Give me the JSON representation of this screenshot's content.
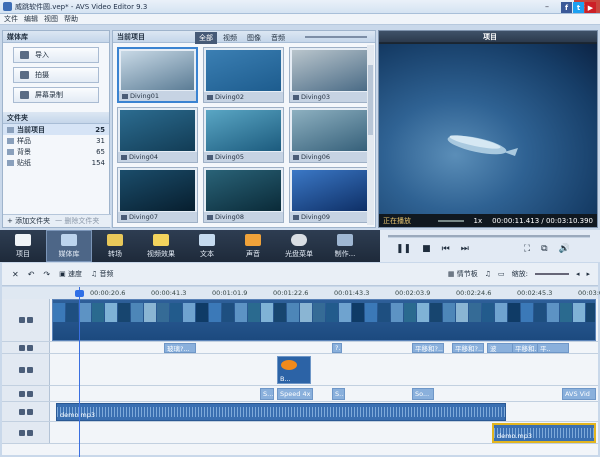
{
  "window": {
    "title": "威跳软件圆.vep* - AVS Video Editor 9.3",
    "minimize": "–",
    "maximize": "□",
    "close": "✕"
  },
  "menu": [
    "文件",
    "编辑",
    "视图",
    "帮助"
  ],
  "social": [
    {
      "name": "facebook",
      "color": "#3b5998",
      "glyph": "f"
    },
    {
      "name": "twitter",
      "color": "#1da1f2",
      "glyph": "t"
    },
    {
      "name": "youtube",
      "color": "#cc2027",
      "glyph": "▶"
    }
  ],
  "library": {
    "header": "媒体库",
    "buttons": [
      "导入",
      "拍摄",
      "屏幕录制"
    ],
    "folders_header": "文件夹",
    "folders": [
      {
        "name": "当前项目",
        "count": "25",
        "selected": true
      },
      {
        "name": "样品",
        "count": "31"
      },
      {
        "name": "背景",
        "count": "65"
      },
      {
        "name": "贴纸",
        "count": "154"
      }
    ],
    "add_folder": "+ 添加文件夹",
    "delete_folder": "一 删除文件夹"
  },
  "project": {
    "header": "当前项目",
    "tabs": [
      "全部",
      "视频",
      "图像",
      "音频"
    ],
    "items": [
      {
        "label": "Diving01",
        "c1": "#c8d9e6",
        "c2": "#5b7c95",
        "selected": true
      },
      {
        "label": "Diving02",
        "c1": "#3b7fb3",
        "c2": "#1d5c8e"
      },
      {
        "label": "Diving03",
        "c1": "#b9c5cc",
        "c2": "#4a6b86"
      },
      {
        "label": "Diving04",
        "c1": "#2c6c90",
        "c2": "#123c55"
      },
      {
        "label": "Diving05",
        "c1": "#5aa6c4",
        "c2": "#1c5b7e"
      },
      {
        "label": "Diving06",
        "c1": "#8db0c0",
        "c2": "#36607a"
      },
      {
        "label": "Diving07",
        "c1": "#1b4d6b",
        "c2": "#071e2e"
      },
      {
        "label": "Diving08",
        "c1": "#2a6378",
        "c2": "#0a2a38"
      },
      {
        "label": "Diving09",
        "c1": "#3b78c6",
        "c2": "#0e2f66"
      }
    ]
  },
  "preview": {
    "header": "项目",
    "status": "正在播放",
    "speed": "1x",
    "time": "00:00:11.413 / 00:03:10.390"
  },
  "toolbar": [
    "项目",
    "媒体库",
    "转场",
    "视频效果",
    "文本",
    "声音",
    "光盘菜单",
    "制作..."
  ],
  "timeline_tools": {
    "speed": "速度",
    "audio": "音频",
    "storyboard": "情节板",
    "zoom": "缩放:"
  },
  "ruler": [
    "00:00:20.6",
    "00:00:41.3",
    "00:01:01.9",
    "00:01:22.6",
    "00:01:43.3",
    "00:02:03.9",
    "00:02:24.6",
    "00:02:45.3",
    "00:03:06.0"
  ],
  "effects": [
    {
      "t": "玻璃?..."
    },
    {
      "t": "?."
    },
    {
      "t": "平移和?..."
    },
    {
      "t": "平移和?..."
    },
    {
      "t": "波"
    },
    {
      "t": "平移和..."
    },
    {
      "t": "平.."
    }
  ],
  "overlay": "B...",
  "texts": [
    "S...",
    "Speed 4x",
    "S...",
    "So...",
    "AVS Vid"
  ],
  "audio1": "demo.mp3",
  "audio2": "demo.mp3"
}
